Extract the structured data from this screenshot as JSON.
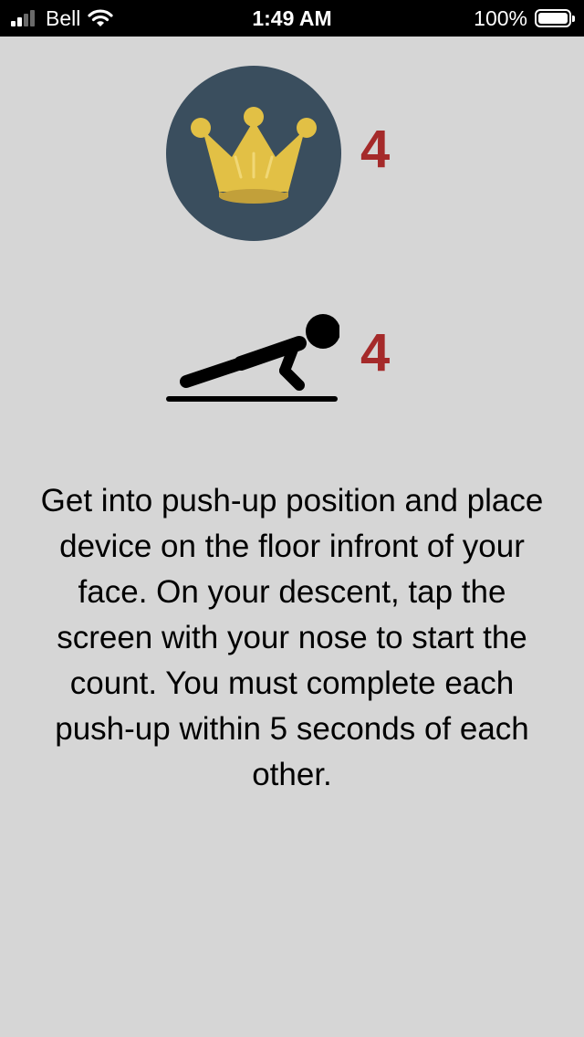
{
  "status_bar": {
    "carrier": "Bell",
    "time": "1:49 AM",
    "battery_percent": "100%",
    "signal_bars_filled": 2,
    "signal_bars_total": 4,
    "wifi_icon": "wifi-icon",
    "battery_icon": "battery-icon"
  },
  "badges": {
    "crown": {
      "icon": "crown-icon",
      "count": "4",
      "circle_color": "#3a4e5e",
      "crown_color": "#e2c045"
    },
    "pushup": {
      "icon": "pushup-icon",
      "count": "4"
    }
  },
  "colors": {
    "background": "#d6d6d6",
    "number": "#a52a2a"
  },
  "instructions": {
    "text": "Get into push-up position and place device on the floor infront of your face. On your descent, tap the screen with your nose to start the count. You must complete each push-up within 5 seconds of each other."
  }
}
